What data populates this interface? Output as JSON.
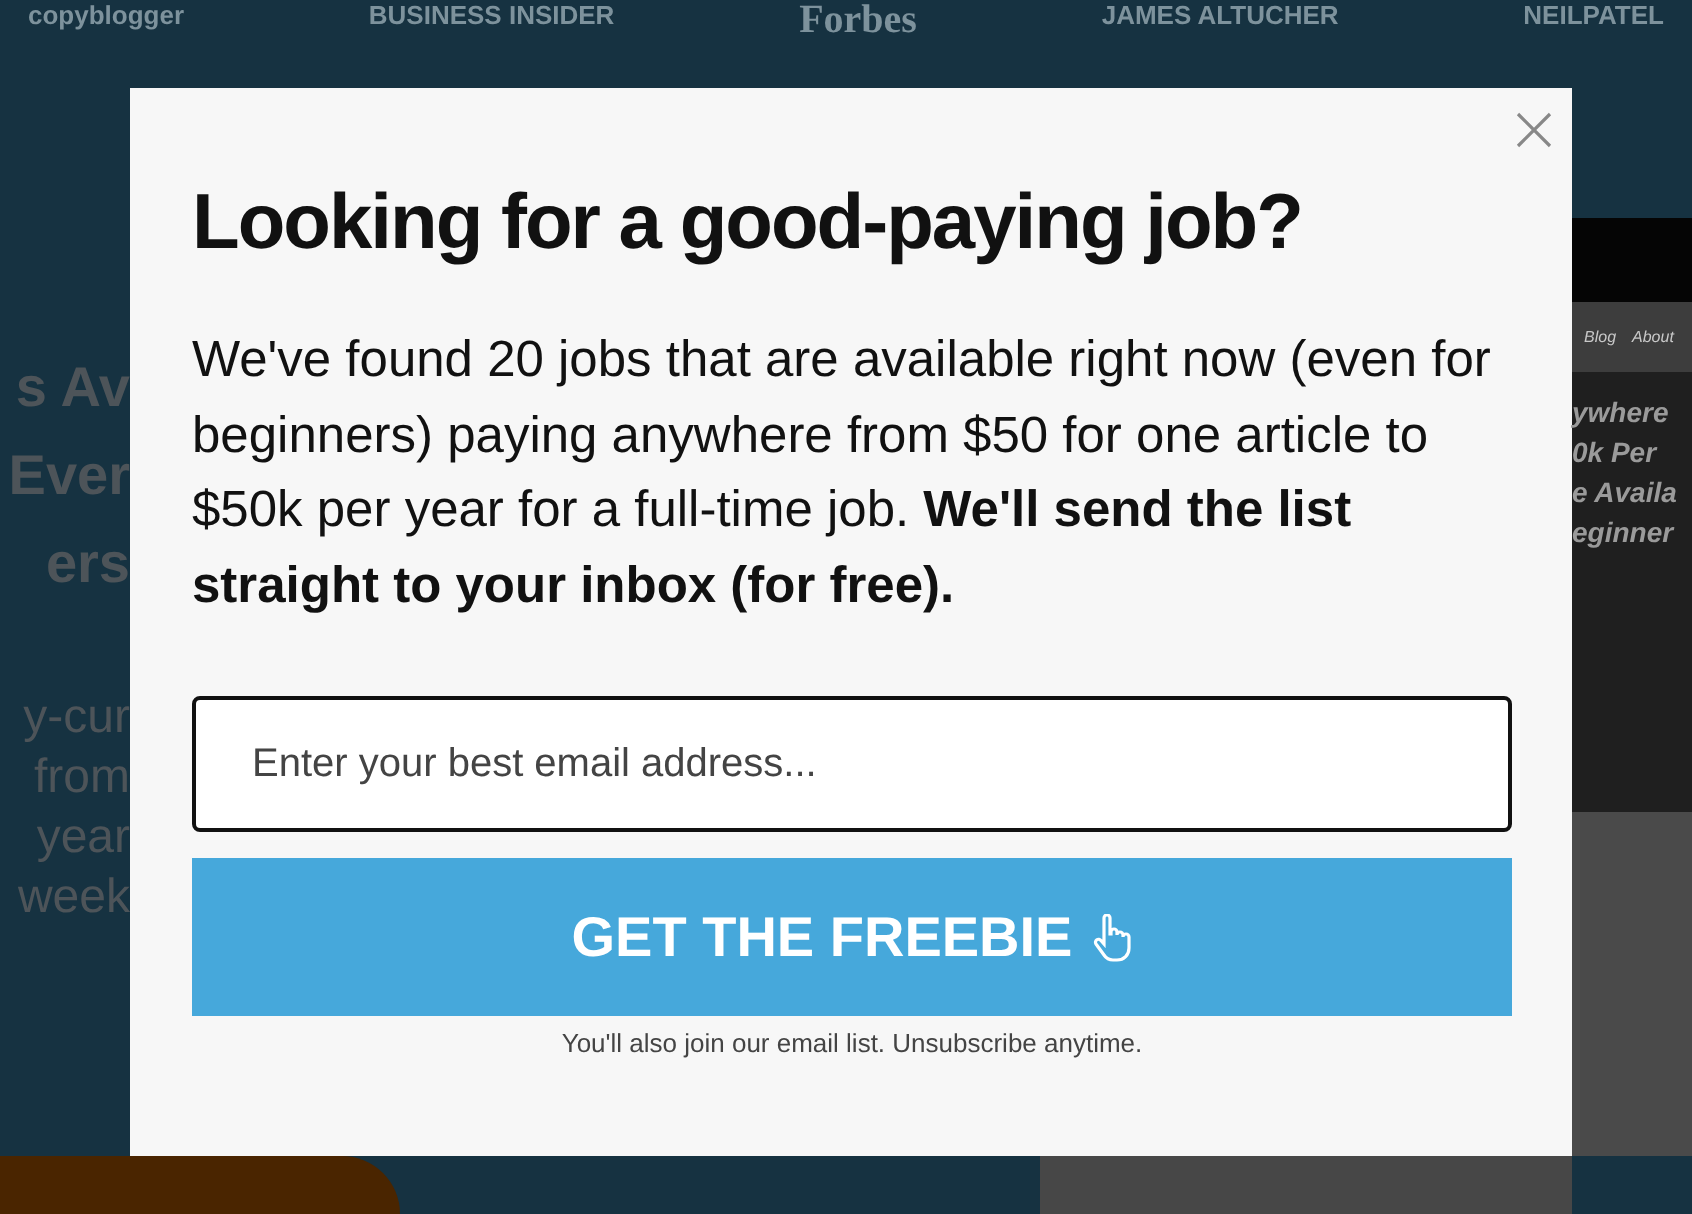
{
  "background": {
    "logos": [
      "copyblogger",
      "BUSINESS INSIDER",
      "Forbes",
      "JAMES ALTUCHER",
      "NEILPATEL"
    ],
    "hero": {
      "heading_lines": [
        "s Av",
        "Ever",
        "ers"
      ],
      "body_lines": [
        "y-cur",
        "from",
        "year",
        "week"
      ]
    },
    "laptop": {
      "nav_items": [
        "Blog",
        "About"
      ],
      "heading_lines": [
        "ywhere",
        "0k Per",
        "e Availa",
        "eginner"
      ]
    }
  },
  "modal": {
    "title": "Looking for a good-paying job?",
    "message": "We've found 20 jobs that are available right now (even for beginners) paying anywhere from $50 for one article to $50k per year for a full-time job. **We'll send the list straight to your inbox (for free).**",
    "email_field": {
      "placeholder": "Enter your best email address..."
    },
    "button": "GET THE FREEBIE",
    "note": "You'll also join our email list. Unsubscribe anytime."
  }
}
